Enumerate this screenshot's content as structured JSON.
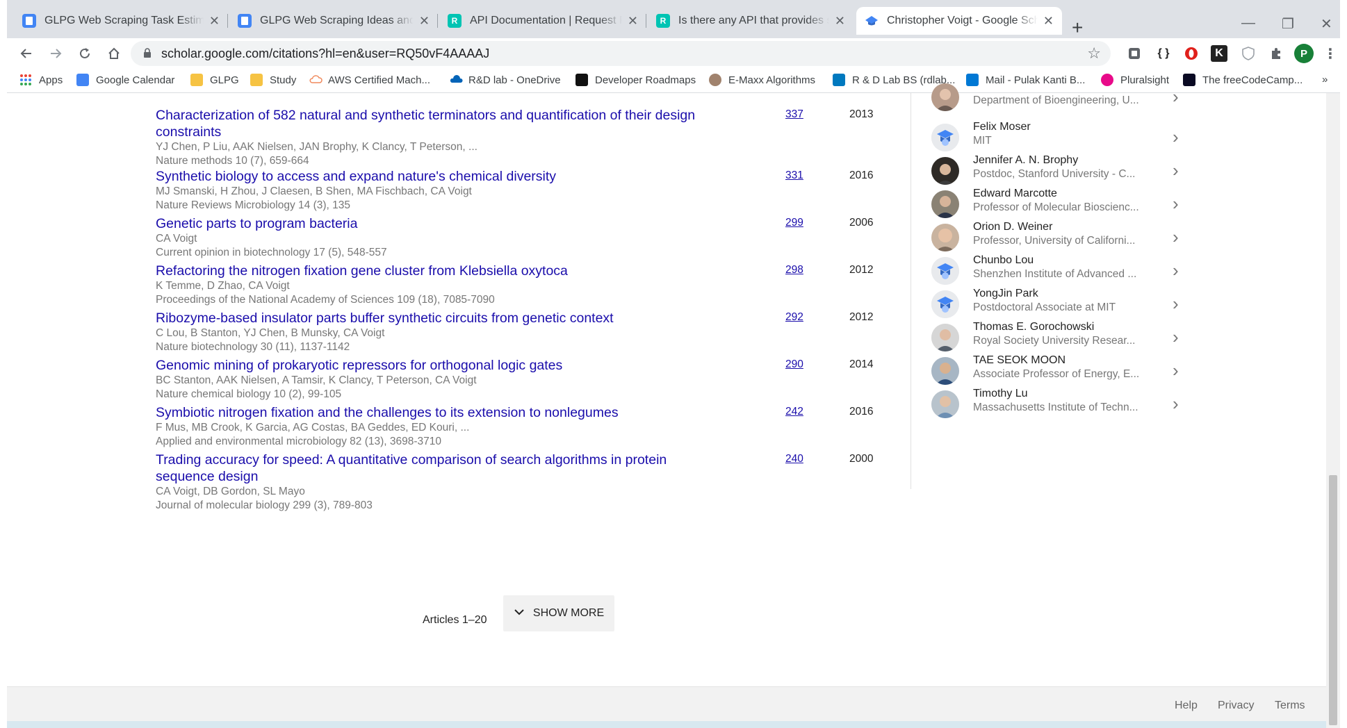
{
  "browser": {
    "tabs": [
      {
        "title": "GLPG Web Scraping Task Estimat",
        "icon": "docs-icon"
      },
      {
        "title": "GLPG Web Scraping Ideas and P",
        "icon": "docs-icon"
      },
      {
        "title": "API Documentation | Request PD",
        "icon": "researchgate-icon"
      },
      {
        "title": "Is there any API that provides sea",
        "icon": "researchgate-icon"
      },
      {
        "title": "Christopher Voigt - Google Schol",
        "icon": "scholar-icon"
      }
    ],
    "url": "scholar.google.com/citations?hl=en&user=RQ50vF4AAAAJ",
    "profile_initial": "P",
    "bookmarks": [
      {
        "label": "Apps"
      },
      {
        "label": "Google Calendar"
      },
      {
        "label": "GLPG"
      },
      {
        "label": "Study"
      },
      {
        "label": "AWS Certified Mach..."
      },
      {
        "label": "R&D lab - OneDrive"
      },
      {
        "label": "Developer Roadmaps"
      },
      {
        "label": "E-Maxx Algorithms"
      },
      {
        "label": "R & D Lab BS (rdlab..."
      },
      {
        "label": "Mail - Pulak Kanti B..."
      },
      {
        "label": "Pluralsight"
      },
      {
        "label": "The freeCodeCamp..."
      }
    ],
    "bookmarks_overflow": "»",
    "ext_braces": "{ }",
    "ext_k": "K"
  },
  "articles": [
    {
      "title": "Characterization of 582 natural and synthetic terminators and quantification of their design constraints",
      "authors": "YJ Chen, P Liu, AAK Nielsen, JAN Brophy, K Clancy, T Peterson, ...",
      "venue": "Nature methods 10 (7), 659-664",
      "cites": "337",
      "year": "2013"
    },
    {
      "title": "Synthetic biology to access and expand nature's chemical diversity",
      "authors": "MJ Smanski, H Zhou, J Claesen, B Shen, MA Fischbach, CA Voigt",
      "venue": "Nature Reviews Microbiology 14 (3), 135",
      "cites": "331",
      "year": "2016"
    },
    {
      "title": "Genetic parts to program bacteria",
      "authors": "CA Voigt",
      "venue": "Current opinion in biotechnology 17 (5), 548-557",
      "cites": "299",
      "year": "2006"
    },
    {
      "title": "Refactoring the nitrogen fixation gene cluster from Klebsiella oxytoca",
      "authors": "K Temme, D Zhao, CA Voigt",
      "venue": "Proceedings of the National Academy of Sciences 109 (18), 7085-7090",
      "cites": "298",
      "year": "2012"
    },
    {
      "title": "Ribozyme-based insulator parts buffer synthetic circuits from genetic context",
      "authors": "C Lou, B Stanton, YJ Chen, B Munsky, CA Voigt",
      "venue": "Nature biotechnology 30 (11), 1137-1142",
      "cites": "292",
      "year": "2012"
    },
    {
      "title": "Genomic mining of prokaryotic repressors for orthogonal logic gates",
      "authors": "BC Stanton, AAK Nielsen, A Tamsir, K Clancy, T Peterson, CA Voigt",
      "venue": "Nature chemical biology 10 (2), 99-105",
      "cites": "290",
      "year": "2014"
    },
    {
      "title": "Symbiotic nitrogen fixation and the challenges to its extension to nonlegumes",
      "authors": "F Mus, MB Crook, K Garcia, AG Costas, BA Geddes, ED Kouri, ...",
      "venue": "Applied and environmental microbiology 82 (13), 3698-3710",
      "cites": "242",
      "year": "2016"
    },
    {
      "title": "Trading accuracy for speed: A quantitative comparison of search algorithms in protein sequence design",
      "authors": "CA Voigt, DB Gordon, SL Mayo",
      "venue": "Journal of molecular biology 299 (3), 789-803",
      "cites": "240",
      "year": "2000"
    }
  ],
  "coauthors": [
    {
      "name": "",
      "affiliation": "Department of Bioengineering, U...",
      "avatar": "photo"
    },
    {
      "name": "Felix Moser",
      "affiliation": "MIT",
      "avatar": "default"
    },
    {
      "name": "Jennifer A. N. Brophy",
      "affiliation": "Postdoc, Stanford University - C...",
      "avatar": "photo"
    },
    {
      "name": "Edward Marcotte",
      "affiliation": "Professor of Molecular Bioscienc...",
      "avatar": "photo"
    },
    {
      "name": "Orion D. Weiner",
      "affiliation": "Professor, University of Californi...",
      "avatar": "photo"
    },
    {
      "name": "Chunbo Lou",
      "affiliation": "Shenzhen Institute of Advanced ...",
      "avatar": "default"
    },
    {
      "name": "YongJin Park",
      "affiliation": "Postdoctoral Associate at MIT",
      "avatar": "default"
    },
    {
      "name": "Thomas E. Gorochowski",
      "affiliation": "Royal Society University Resear...",
      "avatar": "photo"
    },
    {
      "name": "TAE SEOK MOON",
      "affiliation": "Associate Professor of Energy, E...",
      "avatar": "photo"
    },
    {
      "name": "Timothy Lu",
      "affiliation": "Massachusetts Institute of Techn...",
      "avatar": "photo"
    }
  ],
  "pagination": {
    "range_label": "Articles 1–20",
    "show_more_label": "SHOW MORE"
  },
  "footer": {
    "help": "Help",
    "privacy": "Privacy",
    "terms": "Terms"
  },
  "colors": {
    "link": "#1a0dab",
    "muted": "#777777",
    "chrome": "#dee1e6"
  }
}
